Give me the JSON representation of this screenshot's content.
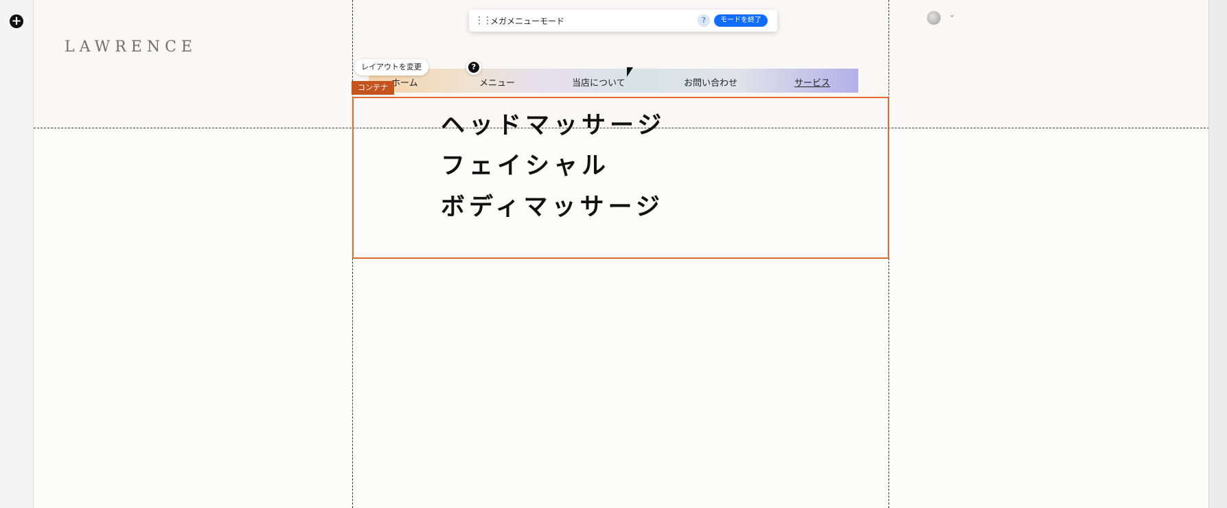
{
  "editor": {
    "add_icon": "plus-circle-icon",
    "mega_menu_toolbar": {
      "drag_icon": "drag-handle-icon",
      "title": "メガメニューモード",
      "help_label": "?",
      "exit_label": "モードを終了"
    },
    "layout_change_label": "レイアウトを変更",
    "layout_help_label": "?",
    "container_label": "コンテナ",
    "avatar_chevron_icon": "chevron-down-icon"
  },
  "site": {
    "logo": "LAWRENCE",
    "nav": [
      {
        "label": "ホーム"
      },
      {
        "label": "メニュー"
      },
      {
        "label": "当店について"
      },
      {
        "label": "お問い合わせ"
      },
      {
        "label": "サービス",
        "active": true
      }
    ],
    "services": [
      {
        "label": "ヘッドマッサージ"
      },
      {
        "label": "フェイシャル"
      },
      {
        "label": "ボディマッサージ"
      }
    ]
  },
  "colors": {
    "accent_orange": "#e6682c",
    "container_tag": "#c4531d",
    "primary_blue": "#116dff"
  }
}
